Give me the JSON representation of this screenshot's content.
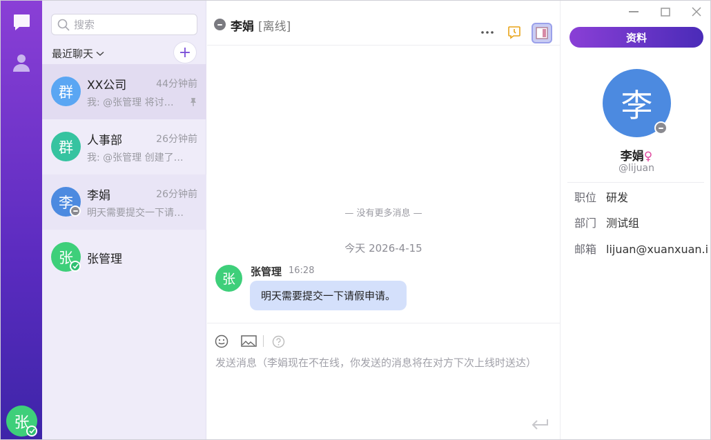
{
  "rail": {
    "user_avatar": "张"
  },
  "list": {
    "search_placeholder": "搜索",
    "recent_label": "最近聊天",
    "add_label": "+",
    "items": [
      {
        "avatar": "群",
        "avatar_color": "#5aa6f3",
        "name": "XX公司",
        "time": "44分钟前",
        "preview": "我: @张管理 将讨…",
        "pinned": true
      },
      {
        "avatar": "群",
        "avatar_color": "#36c3a0",
        "name": "人事部",
        "time": "26分钟前",
        "preview": "我: @张管理 创建了…"
      },
      {
        "avatar": "李",
        "avatar_color": "#4c8ae0",
        "name": "李娟",
        "time": "26分钟前",
        "preview": "明天需要提交一下请…",
        "status": "offline"
      },
      {
        "avatar": "张",
        "avatar_color": "#3ecf7a",
        "name": "张管理",
        "status": "online"
      }
    ]
  },
  "chat": {
    "title": "李娟",
    "status": "[离线]",
    "no_more": "— 没有更多消息 —",
    "date": "今天 2026-4-15",
    "message": {
      "avatar": "张",
      "sender": "张管理",
      "time": "16:28",
      "text": "明天需要提交一下请假申请。"
    },
    "input_placeholder": "发送消息（李娟现在不在线，你发送的消息将在对方下次上线时送达）"
  },
  "profile": {
    "tab_label": "资料",
    "avatar": "李",
    "name": "李娟",
    "gender_symbol": "♀",
    "handle": "@lijuan",
    "fields": [
      {
        "label": "职位",
        "value": "研发"
      },
      {
        "label": "部门",
        "value": "测试组"
      },
      {
        "label": "邮箱",
        "value": "lijuan@xuanxuan.i"
      }
    ]
  },
  "colors": {
    "accent": "#7a4fd8",
    "online": "#2fbf71",
    "bubble": "#d4e0fb",
    "female": "#e0479e"
  }
}
